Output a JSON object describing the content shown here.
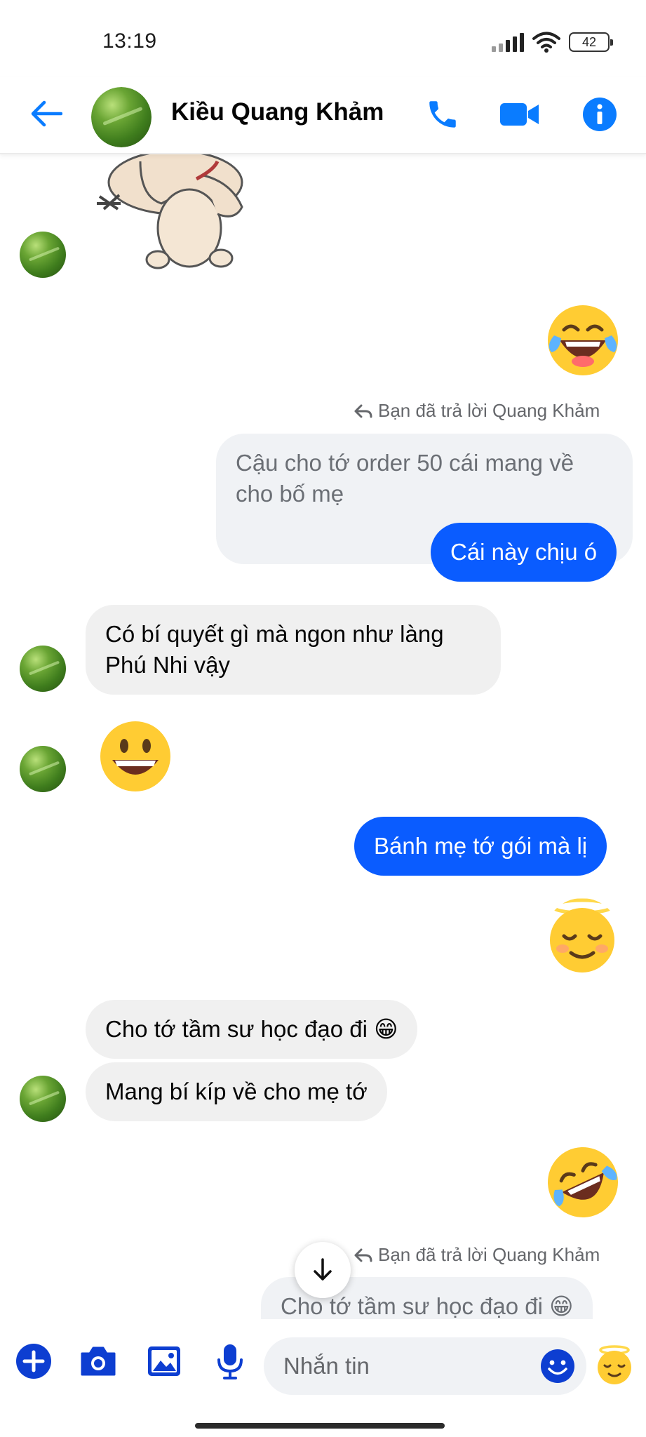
{
  "status_bar": {
    "time": "13:19",
    "battery": "42"
  },
  "header": {
    "contact_name": "Kiều Quang Khảm",
    "icons": {
      "back": "back-arrow-icon",
      "call": "phone-icon",
      "video": "video-camera-icon",
      "info": "info-icon"
    },
    "accent_color": "#0a5cff"
  },
  "messages": {
    "reply_label_1": "Bạn đã trả lời Quang Khảm",
    "quote_1": "Cậu cho tớ order 50 cái mang về cho bố mẹ",
    "out_1": "Cái này chịu ó",
    "in_1": "Có bí quyết gì mà ngon như làng Phú Nhi vậy",
    "out_2": "Bánh mẹ tớ gói mà lị",
    "in_2": "Cho tớ tầm sư học đạo đi 😁",
    "in_3": "Mang bí kíp về cho mẹ tớ",
    "reply_label_2": "Bạn đã trả lời Quang Khảm",
    "quote_2": "Cho tớ tầm sư học đạo đi 😁"
  },
  "composer": {
    "placeholder": "Nhắn tin",
    "icons": [
      "plus-icon",
      "camera-icon",
      "image-icon",
      "microphone-icon",
      "emoji-picker-icon",
      "quick-reaction-icon"
    ]
  }
}
